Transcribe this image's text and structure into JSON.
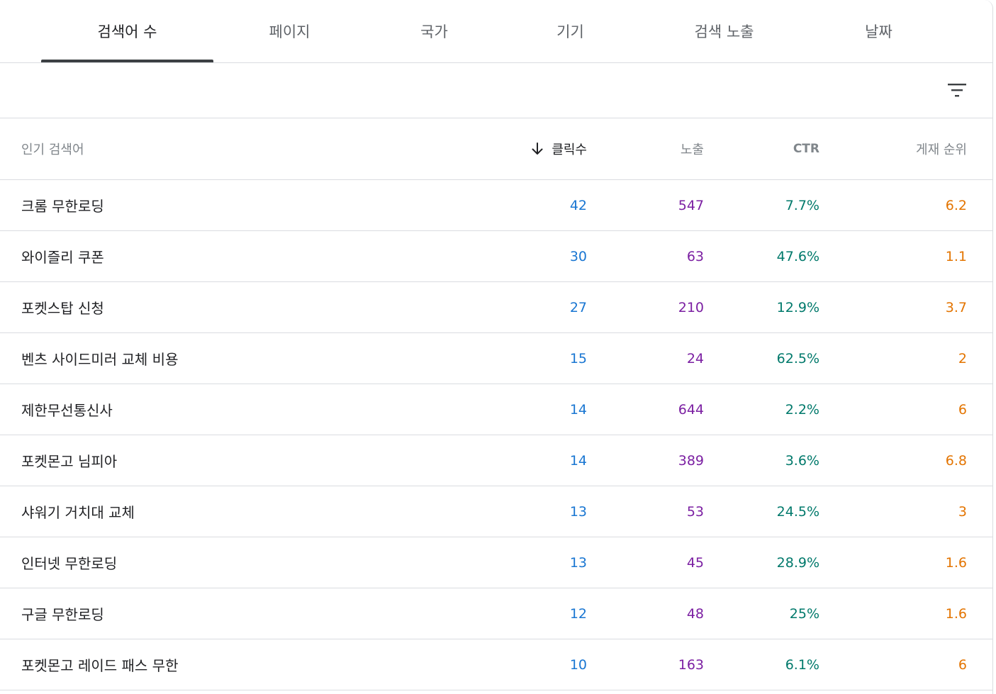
{
  "tabs": [
    {
      "label": "검색어 수",
      "active": true
    },
    {
      "label": "페이지",
      "active": false
    },
    {
      "label": "국가",
      "active": false
    },
    {
      "label": "기기",
      "active": false
    },
    {
      "label": "검색 노출",
      "active": false
    },
    {
      "label": "날짜",
      "active": false
    }
  ],
  "filter": {
    "icon": "filter-list-icon"
  },
  "table": {
    "headers": {
      "query": "인기 검색어",
      "clicks": "클릭수",
      "impressions": "노출",
      "ctr": "CTR",
      "position": "게재 순위"
    },
    "sort_icon": "arrow-down-icon",
    "rows": [
      {
        "query": "크롬 무한로딩",
        "clicks": "42",
        "impressions": "547",
        "ctr": "7.7%",
        "position": "6.2"
      },
      {
        "query": "와이즐리 쿠폰",
        "clicks": "30",
        "impressions": "63",
        "ctr": "47.6%",
        "position": "1.1"
      },
      {
        "query": "포켓스탑 신청",
        "clicks": "27",
        "impressions": "210",
        "ctr": "12.9%",
        "position": "3.7"
      },
      {
        "query": "벤츠 사이드미러 교체 비용",
        "clicks": "15",
        "impressions": "24",
        "ctr": "62.5%",
        "position": "2"
      },
      {
        "query": "제한무선통신사",
        "clicks": "14",
        "impressions": "644",
        "ctr": "2.2%",
        "position": "6"
      },
      {
        "query": "포켓몬고 님피아",
        "clicks": "14",
        "impressions": "389",
        "ctr": "3.6%",
        "position": "6.8"
      },
      {
        "query": "샤워기 거치대 교체",
        "clicks": "13",
        "impressions": "53",
        "ctr": "24.5%",
        "position": "3"
      },
      {
        "query": "인터넷 무한로딩",
        "clicks": "13",
        "impressions": "45",
        "ctr": "28.9%",
        "position": "1.6"
      },
      {
        "query": "구글 무한로딩",
        "clicks": "12",
        "impressions": "48",
        "ctr": "25%",
        "position": "1.6"
      },
      {
        "query": "포켓몬고 레이드 패스 무한",
        "clicks": "10",
        "impressions": "163",
        "ctr": "6.1%",
        "position": "6"
      }
    ]
  },
  "colors": {
    "clicks": "#1976d2",
    "impressions": "#7b1fa2",
    "ctr": "#00796b",
    "position": "#e37400"
  }
}
